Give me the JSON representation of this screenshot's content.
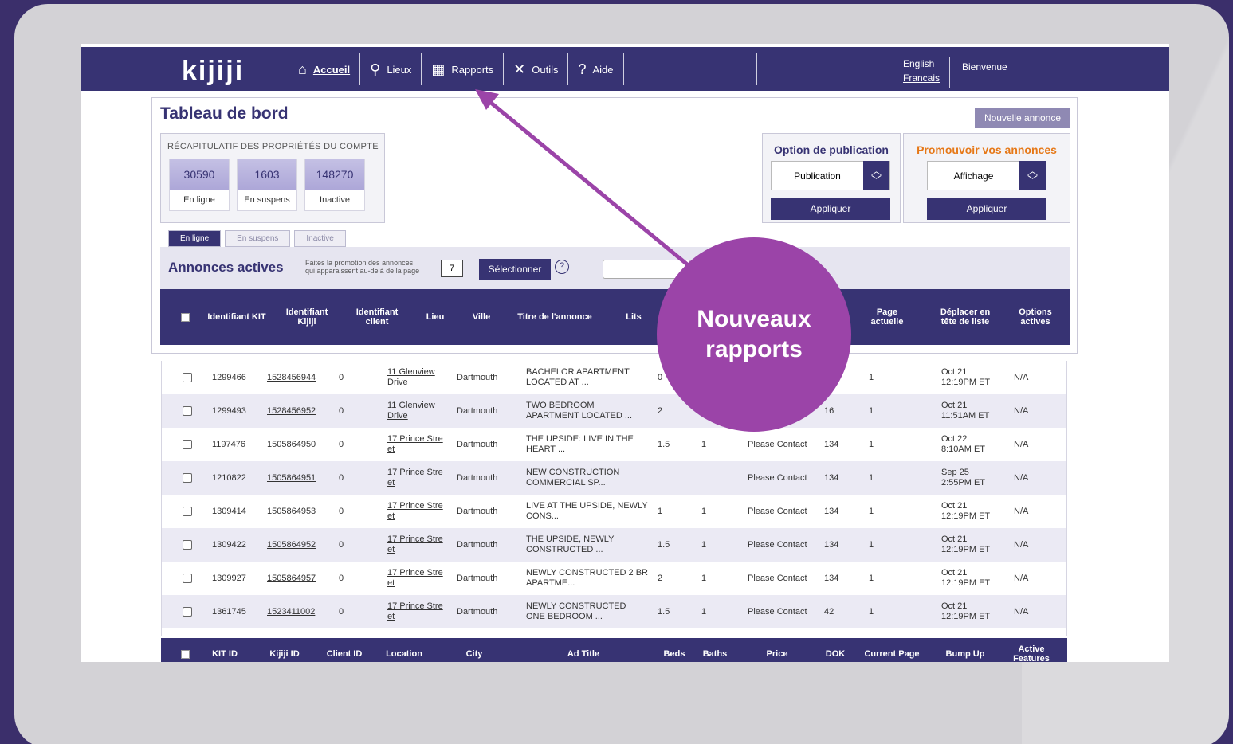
{
  "app": {
    "logo": "kijiji"
  },
  "nav": {
    "items": [
      {
        "label": "Accueil",
        "icon": "home-icon",
        "active": true
      },
      {
        "label": "Lieux",
        "icon": "map-pin-icon",
        "active": false
      },
      {
        "label": "Rapports",
        "icon": "report-icon",
        "active": false
      },
      {
        "label": "Outils",
        "icon": "tools-icon",
        "active": false
      },
      {
        "label": "Aide",
        "icon": "help-icon",
        "active": false
      }
    ]
  },
  "language": {
    "english": "English",
    "french": "Francais"
  },
  "welcome": "Bienvenue",
  "dashboard": {
    "title": "Tableau de bord",
    "new_ad_button": "Nouvelle annonce",
    "recap": {
      "title": "RÉCAPITULATIF DES PROPRIÉTÉS DU COMPTE",
      "stats": [
        {
          "value": "30590",
          "label": "En ligne"
        },
        {
          "value": "1603",
          "label": "En suspens"
        },
        {
          "value": "148270",
          "label": "Inactive"
        }
      ]
    },
    "publication": {
      "title": "Option de publication",
      "selected": "Publication",
      "apply": "Appliquer",
      "title_color": "#373373"
    },
    "promote": {
      "title": "Promouvoir vos annonces",
      "selected": "Affichage",
      "apply": "Appliquer",
      "title_color": "#e67817"
    },
    "tabs": [
      "En ligne",
      "En suspens",
      "Inactive"
    ],
    "active_ads": {
      "title": "Annonces actives",
      "promo_line1": "Faites la promotion des annonces",
      "promo_line2": "qui apparaissent au-delà de la page",
      "page_value": "7",
      "select_button": "Sélectionner",
      "help": "?"
    },
    "header_columns": [
      "Identifiant KIT",
      "Identifiant Kijiji",
      "Identifiant client",
      "Lieu",
      "Ville",
      "Titre de l'annonce",
      "Lits",
      "Page actuelle",
      "Déplacer en tête de liste",
      "Options actives"
    ]
  },
  "rows": [
    {
      "kit": "1299466",
      "kijiji": "1528456944",
      "client": "0",
      "location1": "11 Glenview",
      "location2": "Drive",
      "city": "Dartmouth",
      "title1": "BACHELOR APARTMENT",
      "title2": "LOCATED AT ...",
      "beds": "0",
      "baths": "",
      "price": "",
      "dok": "",
      "page": "1",
      "bump1": "Oct 21",
      "bump2": "12:19PM ET",
      "features": "N/A"
    },
    {
      "kit": "1299493",
      "kijiji": "1528456952",
      "client": "0",
      "location1": "11 Glenview",
      "location2": "Drive",
      "city": "Dartmouth",
      "title1": "TWO BEDROOM",
      "title2": "APARTMENT LOCATED ...",
      "beds": "2",
      "baths": "",
      "price": "",
      "dok": "16",
      "page": "1",
      "bump1": "Oct 21",
      "bump2": "11:51AM ET",
      "features": "N/A"
    },
    {
      "kit": "1197476",
      "kijiji": "1505864950",
      "client": "0",
      "location1": "17 Prince Stre",
      "location2": "et",
      "city": "Dartmouth",
      "title1": "THE UPSIDE: LIVE IN THE",
      "title2": "HEART ...",
      "beds": "1.5",
      "baths": "1",
      "price": "Please Contact",
      "dok": "134",
      "page": "1",
      "bump1": "Oct 22",
      "bump2": "8:10AM ET",
      "features": "N/A"
    },
    {
      "kit": "1210822",
      "kijiji": "1505864951",
      "client": "0",
      "location1": "17 Prince Stre",
      "location2": "et",
      "city": "Dartmouth",
      "title1": "NEW CONSTRUCTION",
      "title2": "COMMERCIAL SP...",
      "beds": "",
      "baths": "",
      "price": "Please Contact",
      "dok": "134",
      "page": "1",
      "bump1": "Sep 25",
      "bump2": "2:55PM ET",
      "features": "N/A"
    },
    {
      "kit": "1309414",
      "kijiji": "1505864953",
      "client": "0",
      "location1": "17 Prince Stre",
      "location2": "et",
      "city": "Dartmouth",
      "title1": "LIVE AT THE UPSIDE, NEWLY",
      "title2": "CONS...",
      "beds": "1",
      "baths": "1",
      "price": "Please Contact",
      "dok": "134",
      "page": "1",
      "bump1": "Oct 21",
      "bump2": "12:19PM ET",
      "features": "N/A"
    },
    {
      "kit": "1309422",
      "kijiji": "1505864952",
      "client": "0",
      "location1": "17 Prince Stre",
      "location2": "et",
      "city": "Dartmouth",
      "title1": "THE UPSIDE, NEWLY",
      "title2": "CONSTRUCTED ...",
      "beds": "1.5",
      "baths": "1",
      "price": "Please Contact",
      "dok": "134",
      "page": "1",
      "bump1": "Oct 21",
      "bump2": "12:19PM ET",
      "features": "N/A"
    },
    {
      "kit": "1309927",
      "kijiji": "1505864957",
      "client": "0",
      "location1": "17 Prince Stre",
      "location2": "et",
      "city": "Dartmouth",
      "title1": "NEWLY CONSTRUCTED 2 BR",
      "title2": "APARTME...",
      "beds": "2",
      "baths": "1",
      "price": "Please Contact",
      "dok": "134",
      "page": "1",
      "bump1": "Oct 21",
      "bump2": "12:19PM ET",
      "features": "N/A"
    },
    {
      "kit": "1361745",
      "kijiji": "1523411002",
      "client": "0",
      "location1": "17 Prince Stre",
      "location2": "et",
      "city": "Dartmouth",
      "title1": "NEWLY CONSTRUCTED",
      "title2": "ONE BEDROOM ...",
      "beds": "1.5",
      "baths": "1",
      "price": "Please Contact",
      "dok": "42",
      "page": "1",
      "bump1": "Oct 21",
      "bump2": "12:19PM ET",
      "features": "N/A"
    }
  ],
  "footer_columns": [
    "KIT ID",
    "Kijiji ID",
    "Client ID",
    "Location",
    "City",
    "Ad Title",
    "Beds",
    "Baths",
    "Price",
    "DOK",
    "Current Page",
    "Bump Up",
    "Active Features"
  ],
  "callout": {
    "line1": "Nouveaux",
    "line2": "rapports",
    "color": "#9b44a8"
  },
  "colors": {
    "brand": "#373373",
    "accent": "#9b44a8",
    "orange": "#e67817"
  }
}
